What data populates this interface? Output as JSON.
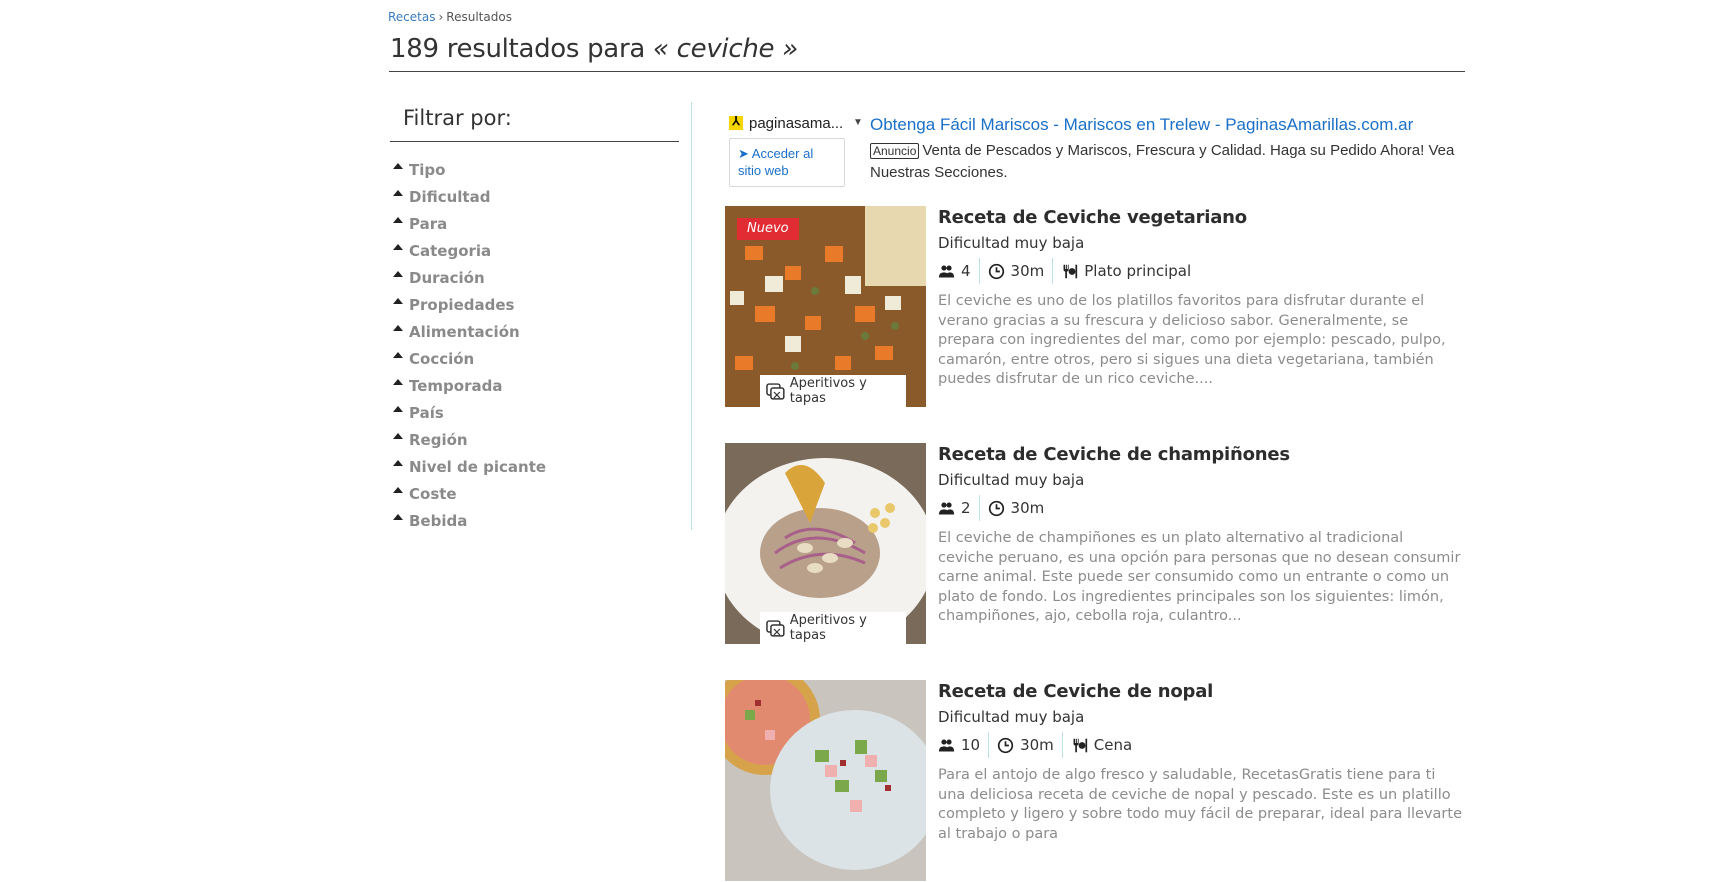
{
  "breadcrumb": {
    "home": "Recetas",
    "separator": "›",
    "current": "Resultados"
  },
  "header": {
    "count_text": "189 resultados para",
    "query": "« ceviche »"
  },
  "sidebar": {
    "title": "Filtrar por:",
    "filters": [
      "Tipo",
      "Dificultad",
      "Para",
      "Categoria",
      "Duración",
      "Propiedades",
      "Alimentación",
      "Cocción",
      "Temporada",
      "País",
      "Región",
      "Nivel de picante",
      "Coste",
      "Bebida"
    ]
  },
  "ad": {
    "source": "paginasama...",
    "visit_label": "➤ Acceder al sitio web",
    "headline": "Obtenga Fácil Mariscos - Mariscos en Trelew - PaginasAmarillas.com.ar",
    "badge": "Anuncio",
    "description": "Venta de Pescados y Mariscos, Frescura y Calidad. Haga su Pedido Ahora! Vea Nuestras Secciones."
  },
  "results": [
    {
      "title": "Receta de Ceviche vegetariano",
      "difficulty": "Dificultad muy baja",
      "servings": "4",
      "time": "30m",
      "course": "Plato principal",
      "badge": "Nuevo",
      "category": "Aperitivos y tapas",
      "description": "El ceviche es uno de los platillos favoritos para disfrutar durante el verano gracias a su frescura y delicioso sabor. Generalmente, se prepara con ingredientes del mar, como por ejemplo: pescado, pulpo, camarón, entre otros, pero si sigues una dieta vegetariana, también puedes disfrutar de un rico ceviche...."
    },
    {
      "title": "Receta de Ceviche de champiñones",
      "difficulty": "Dificultad muy baja",
      "servings": "2",
      "time": "30m",
      "category": "Aperitivos y tapas",
      "description": "El ceviche de champiñones es un plato alternativo al tradicional ceviche peruano, es una opción para personas que no desean consumir carne animal. Este puede ser consumido como un entrante o como un plato de fondo. Los ingredientes principales son los siguientes: limón, champiñones, ajo, cebolla roja, culantro..."
    },
    {
      "title": "Receta de Ceviche de nopal",
      "difficulty": "Dificultad muy baja",
      "servings": "10",
      "time": "30m",
      "course": "Cena",
      "description": "Para el antojo de algo fresco y saludable, RecetasGratis tiene para ti una deliciosa receta de ceviche de nopal y pescado. Este es un platillo completo y ligero y sobre todo muy fácil de preparar, ideal para llevarte al trabajo o para"
    }
  ]
}
